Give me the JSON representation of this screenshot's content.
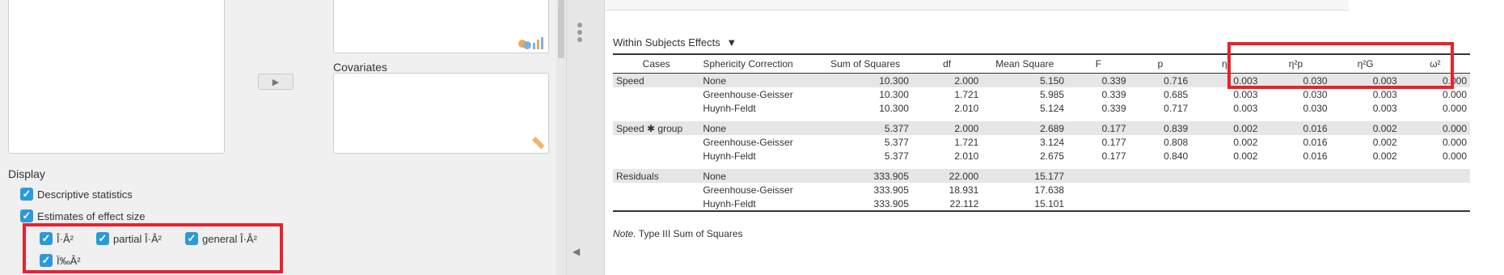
{
  "left_panel": {
    "covariates_label": "Covariates",
    "display_label": "Display",
    "descriptive_label": "Descriptive statistics",
    "effect_size_label": "Estimates of effect size",
    "eta_label": "Î·Â²",
    "partial_eta_label": "partial Î·Â²",
    "general_eta_label": "general Î·Â²",
    "omega_label": "Ï‰Â²",
    "check_mark": "✓",
    "move_arrow": "▶",
    "collapse_arrow": "◀"
  },
  "results": {
    "title": "Within Subjects Effects",
    "title_arrow": "▼",
    "columns": [
      "Cases",
      "Sphericity Correction",
      "Sum of Squares",
      "df",
      "Mean Square",
      "F",
      "p",
      "η²",
      "η²p",
      "η²G",
      "ω²"
    ],
    "rows": [
      [
        "Speed",
        "None",
        "10.300",
        "2.000",
        "5.150",
        "0.339",
        "0.716",
        "0.003",
        "0.030",
        "0.003",
        "0.000"
      ],
      [
        "",
        "Greenhouse-Geisser",
        "10.300",
        "1.721",
        "5.985",
        "0.339",
        "0.685",
        "0.003",
        "0.030",
        "0.003",
        "0.000"
      ],
      [
        "",
        "Huynh-Feldt",
        "10.300",
        "2.010",
        "5.124",
        "0.339",
        "0.717",
        "0.003",
        "0.030",
        "0.003",
        "0.000"
      ],
      [
        "Speed ✱ group",
        "None",
        "5.377",
        "2.000",
        "2.689",
        "0.177",
        "0.839",
        "0.002",
        "0.016",
        "0.002",
        "0.000"
      ],
      [
        "",
        "Greenhouse-Geisser",
        "5.377",
        "1.721",
        "3.124",
        "0.177",
        "0.808",
        "0.002",
        "0.016",
        "0.002",
        "0.000"
      ],
      [
        "",
        "Huynh-Feldt",
        "5.377",
        "2.010",
        "2.675",
        "0.177",
        "0.840",
        "0.002",
        "0.016",
        "0.002",
        "0.000"
      ],
      [
        "Residuals",
        "None",
        "333.905",
        "22.000",
        "15.177",
        "",
        "",
        "",
        "",
        "",
        ""
      ],
      [
        "",
        "Greenhouse-Geisser",
        "333.905",
        "18.931",
        "17.638",
        "",
        "",
        "",
        "",
        "",
        ""
      ],
      [
        "",
        "Huynh-Feldt",
        "333.905",
        "22.112",
        "15.101",
        "",
        "",
        "",
        "",
        "",
        ""
      ]
    ],
    "note_prefix": "Note.",
    "note_text": " Type III Sum of Squares"
  },
  "colors": {
    "highlight": "#e8222c",
    "checkbox": "#2a9bd8",
    "shade": "#e6e6e6"
  }
}
